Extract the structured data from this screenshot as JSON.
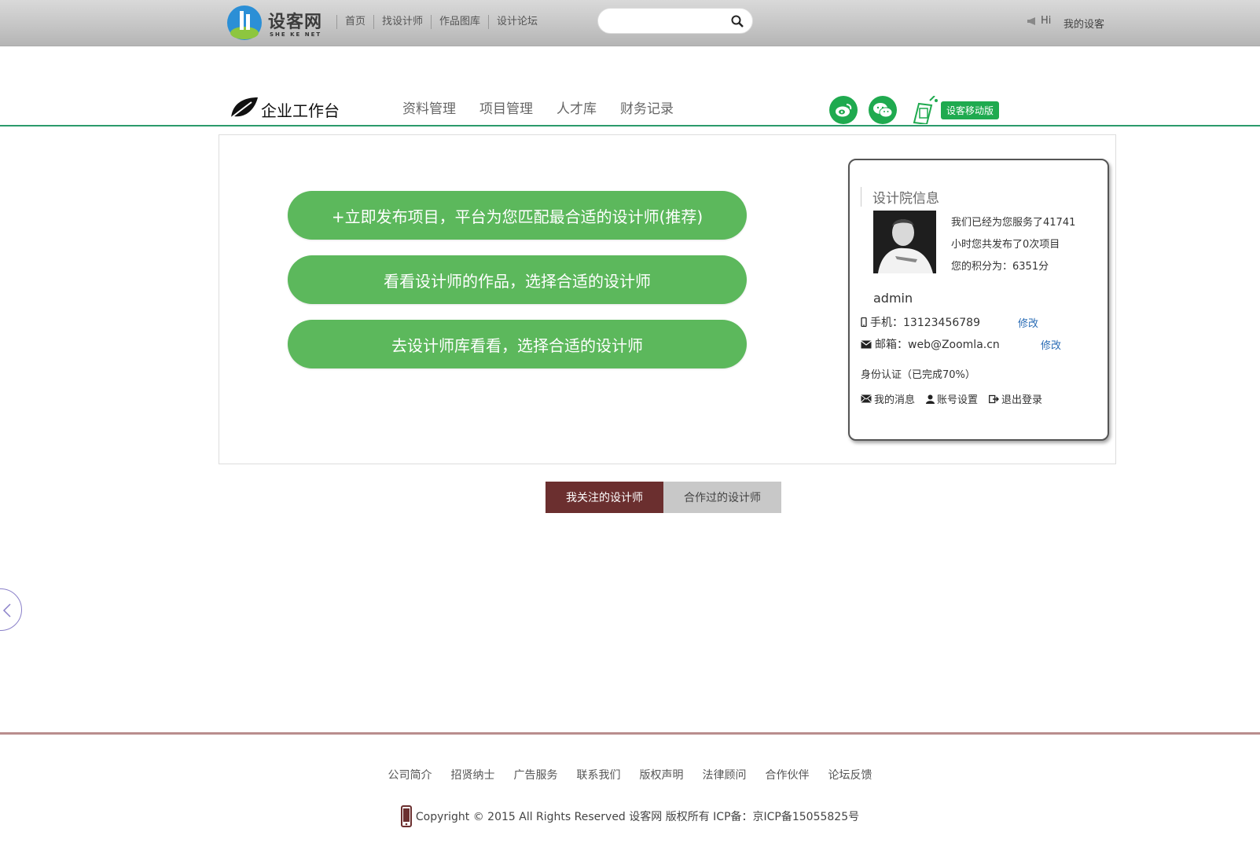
{
  "topbar": {
    "logo_text": "设客网",
    "logo_sub": "SHE KE NET",
    "nav": [
      "首页",
      "找设计师",
      "作品图库",
      "设计论坛"
    ],
    "search_placeholder": "",
    "hi_label": "Hi",
    "mine_label": "我的设客"
  },
  "subhead": {
    "title": "企业工作台",
    "nav": [
      "资料管理",
      "项目管理",
      "人才库",
      "财务记录"
    ],
    "mobile_label": "设客移动版",
    "colors": {
      "accent": "#1faa4f",
      "line": "#2b9a6b"
    }
  },
  "actions": {
    "publish": "+立即发布项目，平台为您匹配最合适的设计师(推荐)",
    "browse_works": "看看设计师的作品，选择合适的设计师",
    "browse_library": "去设计师库看看，选择合适的设计师",
    "color": "#5cb85c"
  },
  "info": {
    "title": "设计院信息",
    "stats_line1": "我们已经为您服务了41741",
    "stats_line2": "小时您共发布了0次项目",
    "stats_line3": "您的积分为：6351分",
    "username": "admin",
    "phone_label": "手机：13123456789",
    "phone_edit": "修改",
    "email_label": "邮箱：web@Zoomla.cn",
    "email_edit": "修改",
    "verify": "身份认证（已完成70%）",
    "messages": "我的消息",
    "account": "账号设置",
    "logout": "退出登录"
  },
  "tabs": {
    "followed": "我关注的设计师",
    "cooperated": "合作过的设计师",
    "active_color": "#6b2f2f"
  },
  "footer": {
    "links": [
      "公司简介",
      "招贤纳士",
      "广告服务",
      "联系我们",
      "版权声明",
      "法律顾问",
      "合作伙伴",
      "论坛反馈"
    ],
    "copyright": "Copyright © 2015 All Rights Reserved 设客网 版权所有 ICP备：京ICP备15055825号"
  }
}
